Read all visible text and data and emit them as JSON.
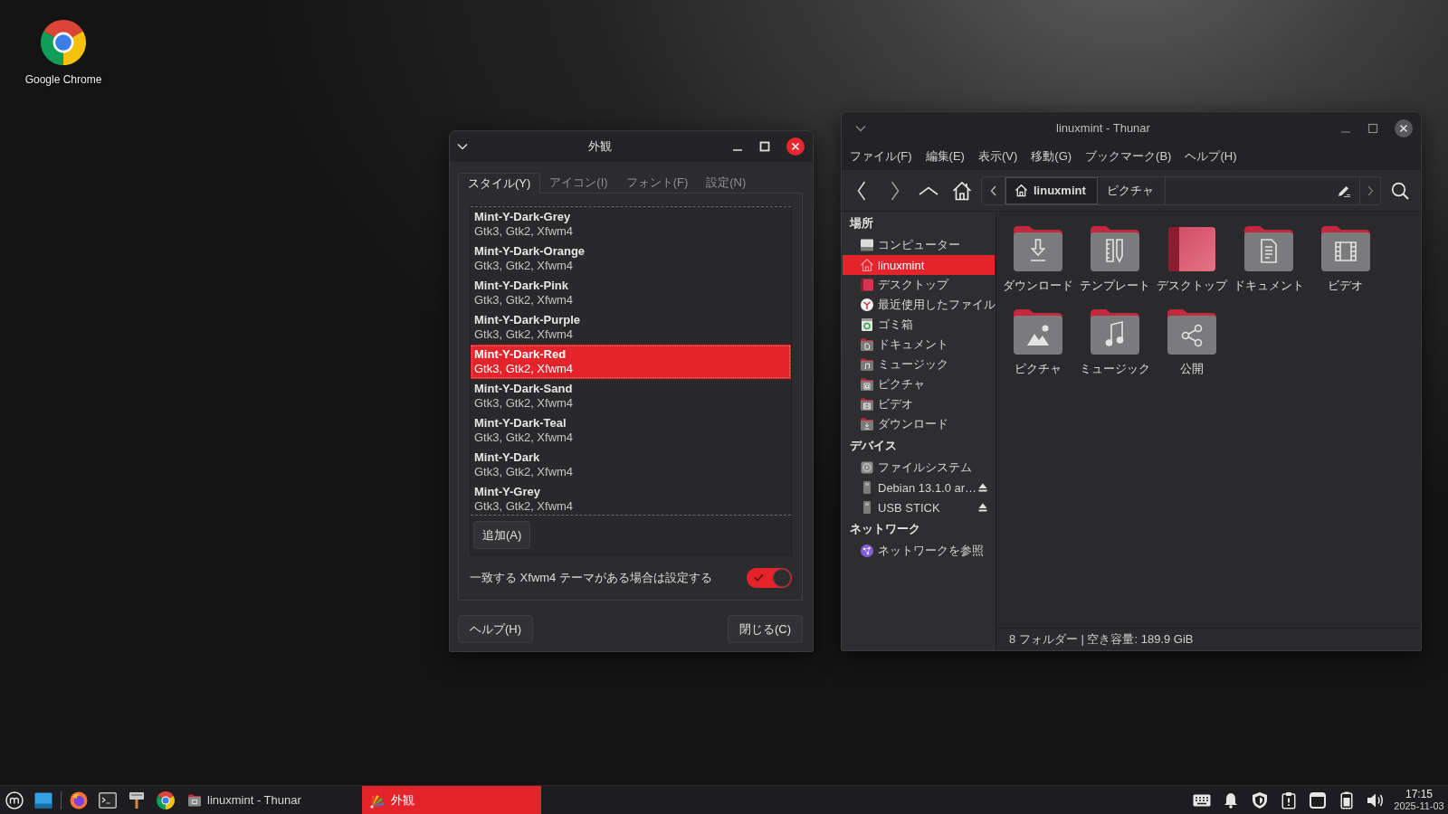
{
  "desktop_icons": [
    {
      "label": "Google Chrome",
      "kind": "chrome"
    }
  ],
  "appearance_dialog": {
    "title": "外観",
    "tabs": [
      {
        "label": "スタイル(Y)",
        "selected": true
      },
      {
        "label": "アイコン(I)",
        "selected": false
      },
      {
        "label": "フォント(F)",
        "selected": false
      },
      {
        "label": "設定(N)",
        "selected": false
      }
    ],
    "themes": [
      {
        "name": "Mint-Y-Dark-Grey",
        "details": "Gtk3, Gtk2, Xfwm4",
        "selected": false
      },
      {
        "name": "Mint-Y-Dark-Orange",
        "details": "Gtk3, Gtk2, Xfwm4",
        "selected": false
      },
      {
        "name": "Mint-Y-Dark-Pink",
        "details": "Gtk3, Gtk2, Xfwm4",
        "selected": false
      },
      {
        "name": "Mint-Y-Dark-Purple",
        "details": "Gtk3, Gtk2, Xfwm4",
        "selected": false
      },
      {
        "name": "Mint-Y-Dark-Red",
        "details": "Gtk3, Gtk2, Xfwm4",
        "selected": true
      },
      {
        "name": "Mint-Y-Dark-Sand",
        "details": "Gtk3, Gtk2, Xfwm4",
        "selected": false
      },
      {
        "name": "Mint-Y-Dark-Teal",
        "details": "Gtk3, Gtk2, Xfwm4",
        "selected": false
      },
      {
        "name": "Mint-Y-Dark",
        "details": "Gtk3, Gtk2, Xfwm4",
        "selected": false
      },
      {
        "name": "Mint-Y-Grey",
        "details": "Gtk3, Gtk2, Xfwm4",
        "selected": false
      }
    ],
    "add_button": "追加(A)",
    "xfwm_option": {
      "label": "一致する Xfwm4 テーマがある場合は設定する",
      "on": true
    },
    "help_button": "ヘルプ(H)",
    "close_button": "閉じる(C)"
  },
  "file_manager": {
    "title": "linuxmint - Thunar",
    "menu": [
      "ファイル(F)",
      "編集(E)",
      "表示(V)",
      "移動(G)",
      "ブックマーク(B)",
      "ヘルプ(H)"
    ],
    "path": [
      {
        "label": "linuxmint",
        "kind": "home",
        "selected": true
      },
      {
        "label": "ピクチャ",
        "kind": "folder",
        "selected": false
      }
    ],
    "sidebar": [
      {
        "title": "場所",
        "items": [
          {
            "label": "コンピューター",
            "kind": "computer",
            "selected": false
          },
          {
            "label": "linuxmint",
            "kind": "home",
            "selected": true
          },
          {
            "label": "デスクトップ",
            "kind": "desktop",
            "selected": false
          },
          {
            "label": "最近使用したファイル",
            "kind": "recent",
            "selected": false
          },
          {
            "label": "ゴミ箱",
            "kind": "trash",
            "selected": false
          },
          {
            "label": "ドキュメント",
            "kind": "documents",
            "selected": false
          },
          {
            "label": "ミュージック",
            "kind": "music",
            "selected": false
          },
          {
            "label": "ピクチャ",
            "kind": "pictures",
            "selected": false
          },
          {
            "label": "ビデオ",
            "kind": "videos",
            "selected": false
          },
          {
            "label": "ダウンロード",
            "kind": "downloads",
            "selected": false
          }
        ]
      },
      {
        "title": "デバイス",
        "items": [
          {
            "label": "ファイルシステム",
            "kind": "filesystem",
            "selected": false,
            "ejectable": false
          },
          {
            "label": "Debian 13.1.0 ar…",
            "kind": "usb",
            "selected": false,
            "ejectable": true
          },
          {
            "label": "USB STICK",
            "kind": "usb",
            "selected": false,
            "ejectable": true
          }
        ]
      },
      {
        "title": "ネットワーク",
        "items": [
          {
            "label": "ネットワークを参照",
            "kind": "network",
            "selected": false
          }
        ]
      }
    ],
    "folders": [
      {
        "label": "ダウンロード",
        "kind": "downloads"
      },
      {
        "label": "テンプレート",
        "kind": "templates"
      },
      {
        "label": "デスクトップ",
        "kind": "desktop"
      },
      {
        "label": "ドキュメント",
        "kind": "documents"
      },
      {
        "label": "ビデオ",
        "kind": "videos"
      },
      {
        "label": "ピクチャ",
        "kind": "pictures"
      },
      {
        "label": "ミュージック",
        "kind": "music"
      },
      {
        "label": "公開",
        "kind": "public"
      }
    ],
    "status_bar": "8 フォルダー | 空き容量: 189.9 GiB"
  },
  "taskbar": {
    "launchers": [
      {
        "kind": "menu"
      },
      {
        "kind": "desktop"
      },
      {
        "kind": "separator"
      },
      {
        "kind": "fox"
      },
      {
        "kind": "terminal"
      },
      {
        "kind": "roller"
      },
      {
        "kind": "chrome"
      }
    ],
    "tasks": [
      {
        "label": "linuxmint - Thunar",
        "kind": "folder",
        "selected": false
      },
      {
        "label": "外観",
        "kind": "appearance",
        "selected": true
      }
    ],
    "tray": [
      {
        "kind": "keyboard"
      },
      {
        "kind": "bell"
      },
      {
        "kind": "shield"
      },
      {
        "kind": "clipboard"
      },
      {
        "kind": "window"
      },
      {
        "kind": "battery"
      },
      {
        "kind": "volume"
      }
    ],
    "clock": {
      "time": "17:15",
      "date": "2025-11-03"
    }
  }
}
